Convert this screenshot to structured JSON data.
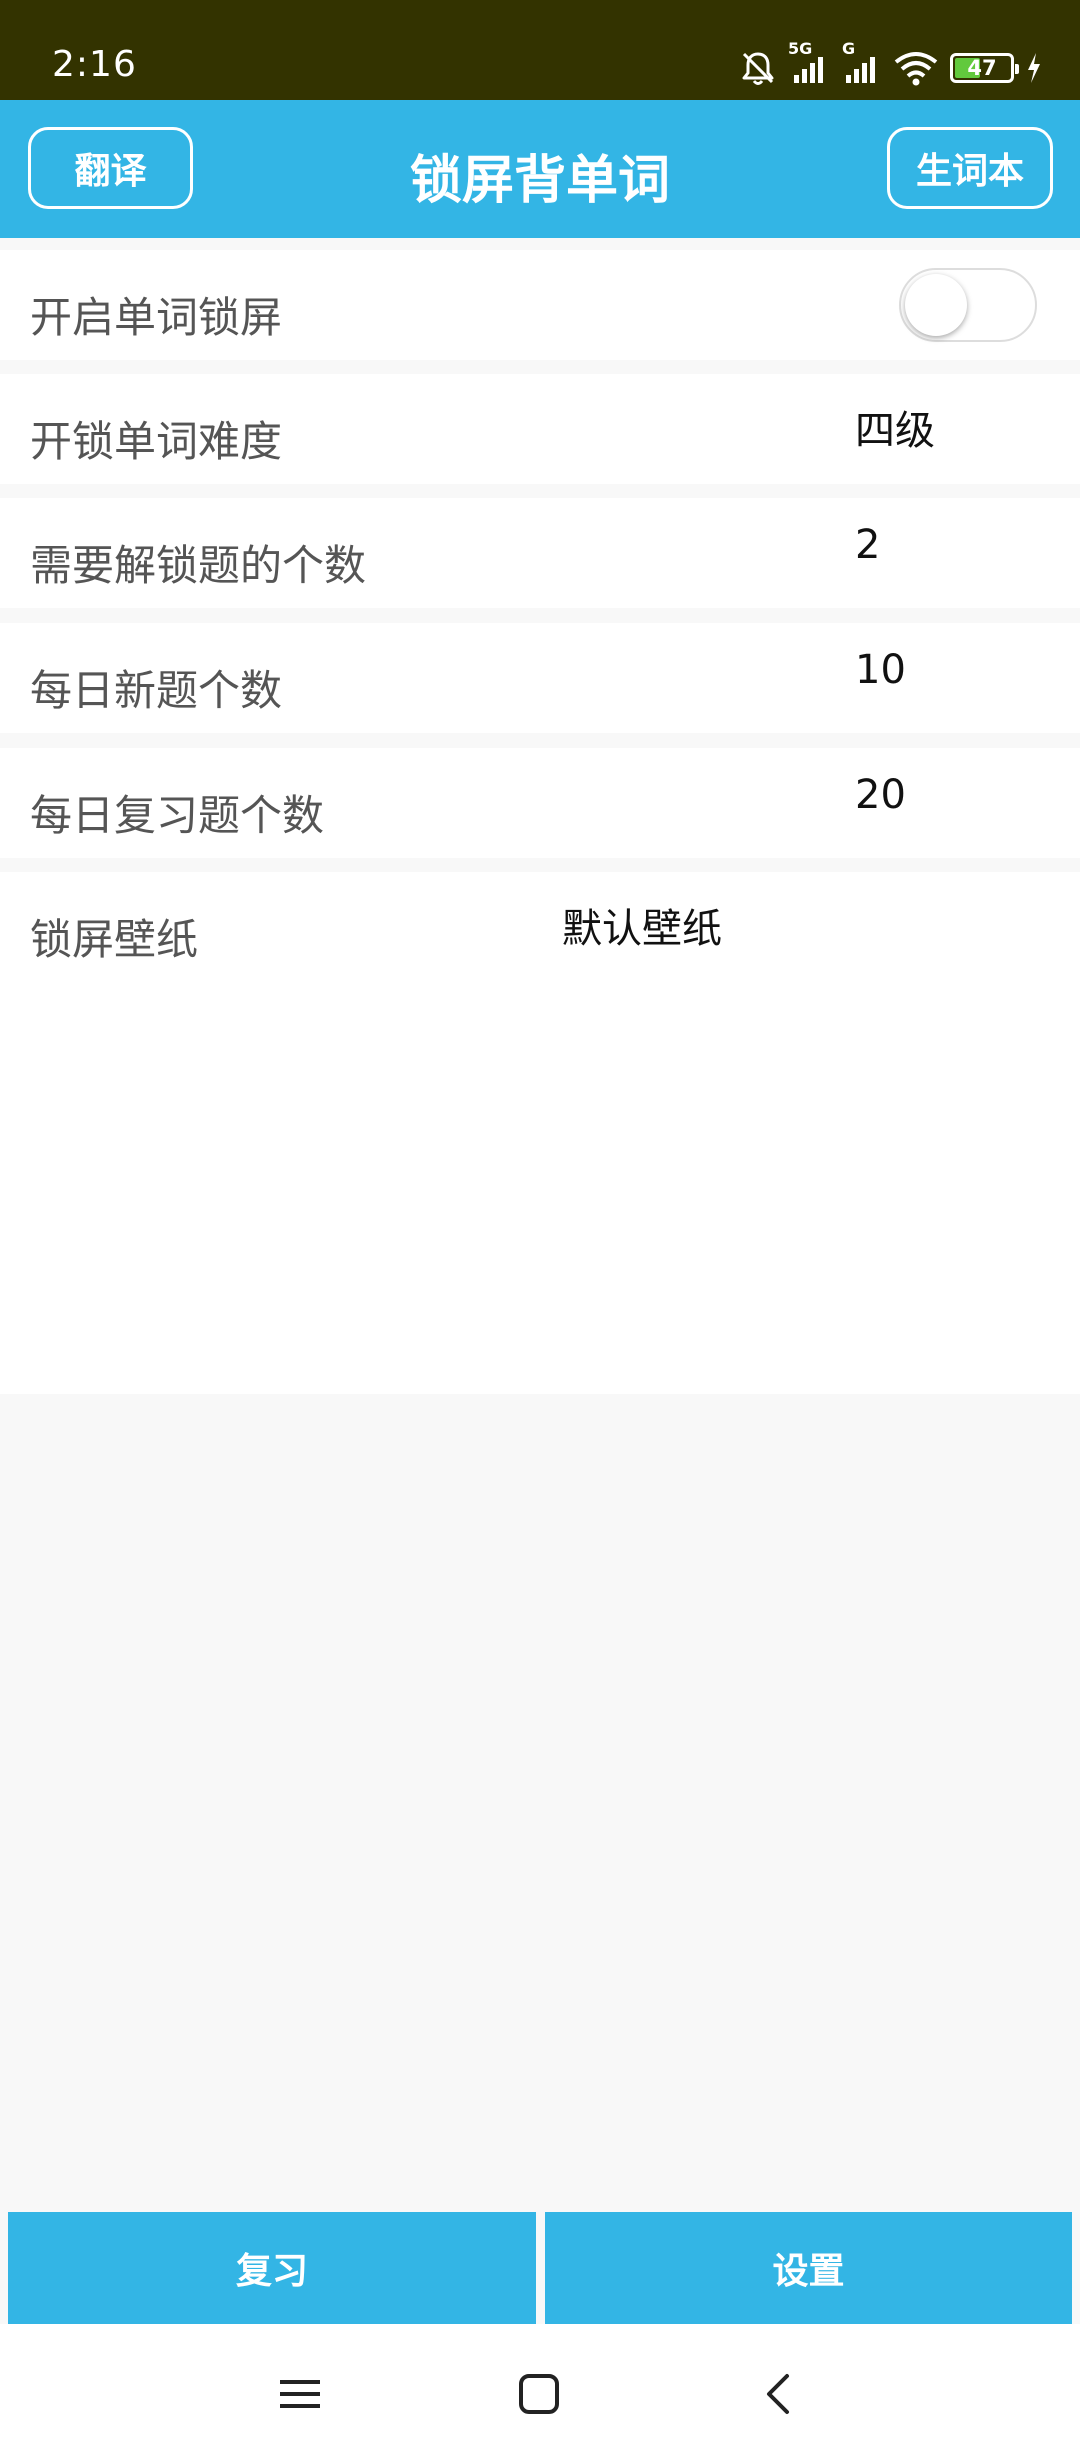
{
  "status_bar": {
    "time": "2:16",
    "network_label": "5G",
    "network_label_2": "G",
    "battery_level": 47,
    "battery_text": "47",
    "icons": [
      "mute-bell-icon",
      "signal-icon",
      "signal-icon",
      "wifi-icon",
      "battery-icon",
      "charging-icon"
    ]
  },
  "app_bar": {
    "title": "锁屏背单词",
    "left_button": "翻译",
    "right_button": "生词本"
  },
  "settings": {
    "enable_lock": {
      "label": "开启单词锁屏",
      "enabled": false
    },
    "difficulty": {
      "label": "开锁单词难度",
      "value": "四级"
    },
    "unlock_count": {
      "label": "需要解锁题的个数",
      "value": "2"
    },
    "daily_new": {
      "label": "每日新题个数",
      "value": "10"
    },
    "daily_review": {
      "label": "每日复习题个数",
      "value": "20"
    },
    "wallpaper": {
      "label": "锁屏壁纸",
      "value": "默认壁纸"
    }
  },
  "bottom_tabs": {
    "review": "复习",
    "settings": "设置"
  },
  "nav": {
    "icons": [
      "menu-icon",
      "home-icon",
      "back-icon"
    ]
  },
  "colors": {
    "status_bar": "#333300",
    "accent": "#33b5e5",
    "battery_fill": "#62c93d",
    "background": "#f8f8f8"
  }
}
